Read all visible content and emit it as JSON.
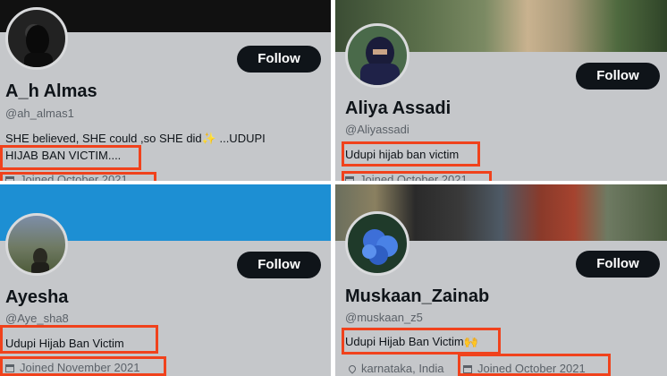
{
  "profiles": [
    {
      "name": "A_h Almas",
      "handle": "@ah_almas1",
      "bio_line1": "SHE believed, SHE could ,so SHE did✨ ...UDUPI",
      "bio_line2": "HIJAB BAN VICTIM....",
      "joined": "Joined October 2021",
      "follow_label": "Follow"
    },
    {
      "name": "Aliya Assadi",
      "handle": "@Aliyassadi",
      "bio": "Udupi hijab ban victim",
      "joined": "Joined October 2021",
      "follow_label": "Follow"
    },
    {
      "name": "Ayesha",
      "handle": "@Aye_sha8",
      "bio": "Udupi Hijab Ban Victim",
      "joined": "Joined November 2021",
      "follow_label": "Follow"
    },
    {
      "name": "Muskaan_Zainab",
      "handle": "@muskaan_z5",
      "bio": "Udupi Hijab Ban Victim🙌",
      "location": "karnataka, India",
      "joined": "Joined October 2021",
      "follow_label": "Follow"
    }
  ],
  "colors": {
    "panel_bg": "#c5c7ca",
    "highlight": "#f0421c",
    "follow_bg": "#0f1419",
    "banner_blue": "#1d8fd3"
  }
}
